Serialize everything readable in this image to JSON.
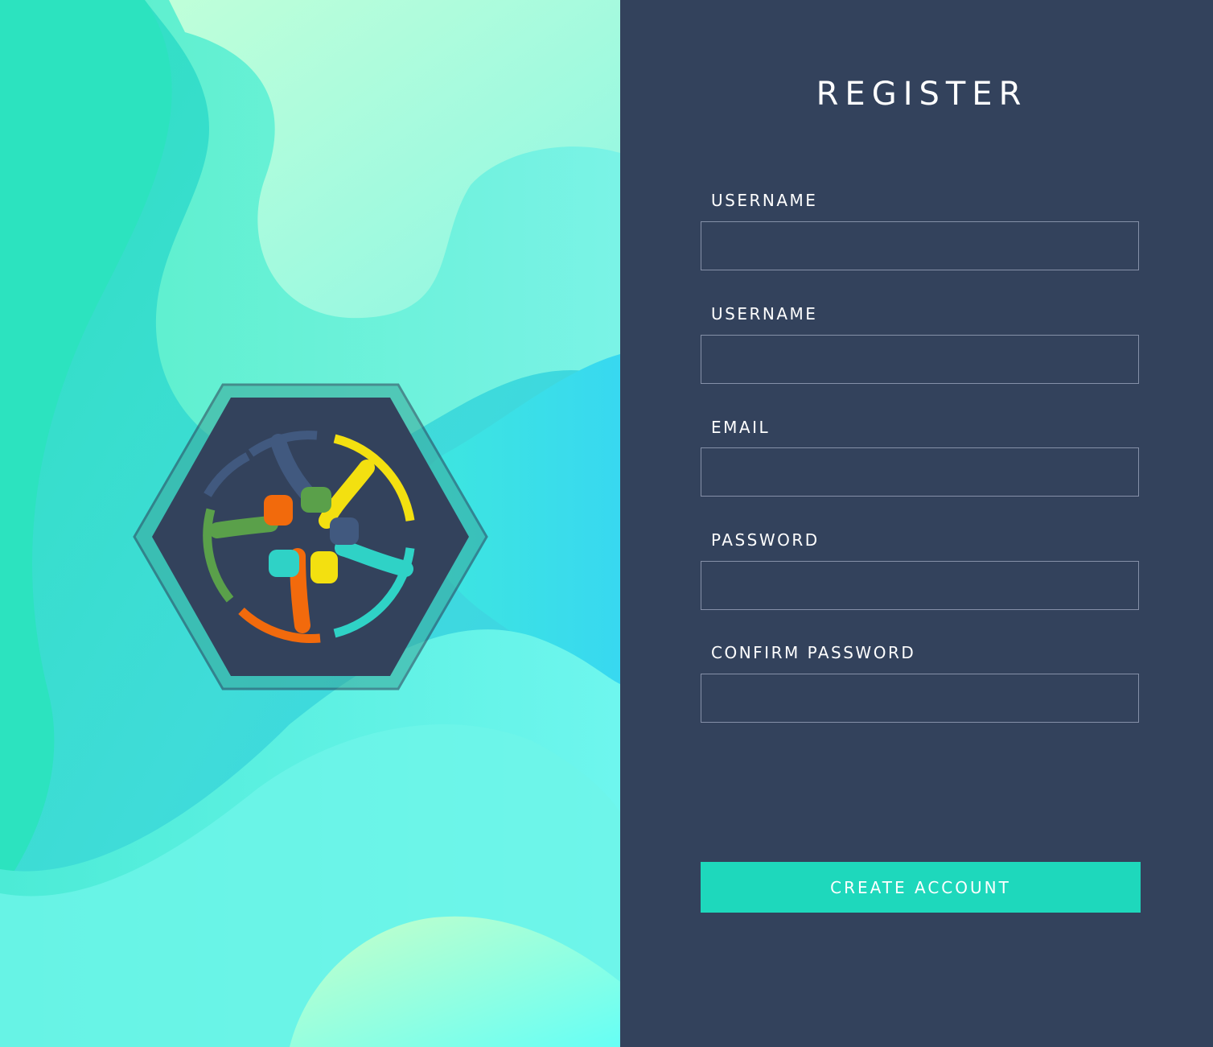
{
  "form": {
    "title": "REGISTER",
    "fields": [
      {
        "label": "USERNAME",
        "value": ""
      },
      {
        "label": "USERNAME",
        "value": ""
      },
      {
        "label": "EMAIL",
        "value": ""
      },
      {
        "label": "PASSWORD",
        "value": ""
      },
      {
        "label": "CONFIRM PASSWORD",
        "value": ""
      }
    ],
    "submit_label": "CREATE ACCOUNT"
  },
  "colors": {
    "panel_background": "#33425c",
    "button_background": "#1ed8bc",
    "input_border": "#8590a8",
    "text": "#ffffff"
  },
  "logo": {
    "icon": "joined-hands-circle-icon",
    "hand_colors": [
      "#f26a0c",
      "#5aa04a",
      "#41597f",
      "#f3e010",
      "#2fd2c6"
    ]
  }
}
